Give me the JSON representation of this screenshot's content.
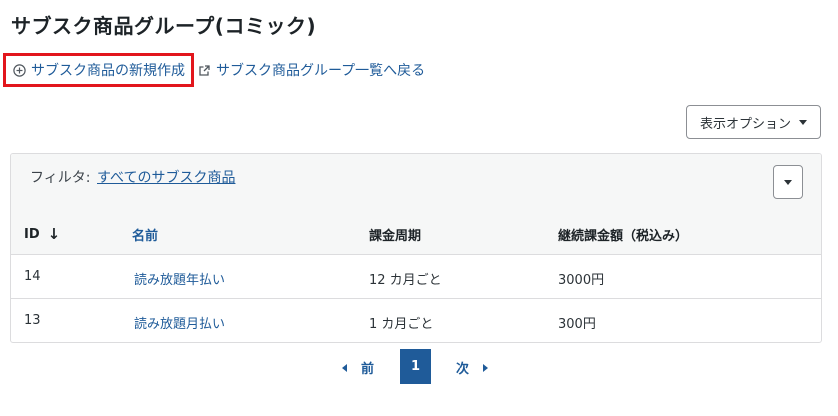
{
  "page": {
    "title": "サブスク商品グループ(コミック)"
  },
  "actions": {
    "new_label": "サブスク商品の新規作成",
    "back_label": "サブスク商品グループ一覧へ戻る",
    "new_icon": "plus-circle-icon",
    "back_icon": "external-link-icon",
    "highlight_color": "#e2161c"
  },
  "toolbar": {
    "options_label": "表示オプション"
  },
  "filter": {
    "label": "フィルタ:",
    "value": "すべてのサブスク商品"
  },
  "table": {
    "columns": [
      {
        "label": "ID",
        "sort": "desc"
      },
      {
        "label": "名前"
      },
      {
        "label": "課金周期"
      },
      {
        "label": "継続課金額（税込み）"
      }
    ],
    "rows": [
      {
        "id": "14",
        "name": "読み放題年払い",
        "period": "12 カ月ごと",
        "amount": "3000円"
      },
      {
        "id": "13",
        "name": "読み放題月払い",
        "period": "1 カ月ごと",
        "amount": "300円"
      }
    ]
  },
  "pagination": {
    "prev": "前",
    "current": "1",
    "next": "次"
  },
  "colors": {
    "link": "#1f5b99",
    "accent": "#1f5b99"
  }
}
